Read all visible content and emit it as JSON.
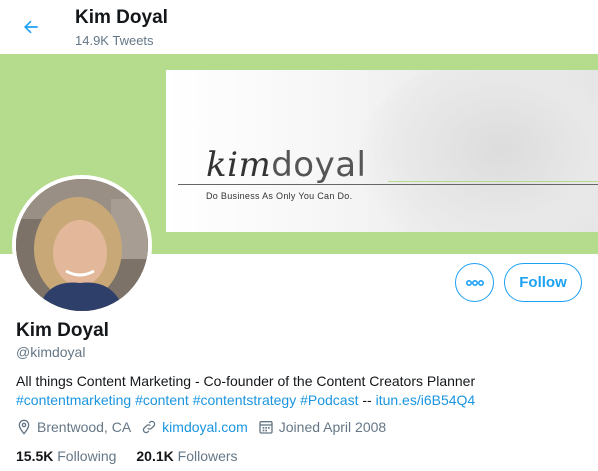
{
  "header": {
    "name": "Kim Doyal",
    "tweet_count": "14.9K Tweets"
  },
  "banner": {
    "logo_kim": "kim",
    "logo_doyal": "doyal",
    "tagline": "Do Business As Only You Can Do.",
    "background_color": "#b5dc8d"
  },
  "actions": {
    "follow_label": "Follow"
  },
  "profile": {
    "name": "Kim Doyal",
    "handle": "@kimdoyal",
    "bio_text": "All things Content Marketing - Co-founder of the Content Creators Planner",
    "bio_tags": [
      "#contentmarketing",
      "#content",
      "#contentstrategy",
      "#Podcast"
    ],
    "bio_separator": "--",
    "bio_link": "itun.es/i6B54Q4",
    "location": "Brentwood, CA",
    "website": "kimdoyal.com",
    "joined": "Joined April 2008"
  },
  "stats": {
    "following_count": "15.5K",
    "following_label": "Following",
    "followers_count": "20.1K",
    "followers_label": "Followers"
  },
  "colors": {
    "accent": "#1da1f2",
    "link": "#1b95e0",
    "secondary_text": "#657786"
  },
  "icons": {
    "back": "arrow-left-icon",
    "more": "more-horizontal-icon",
    "location": "location-pin-icon",
    "website": "link-icon",
    "joined": "calendar-icon"
  }
}
